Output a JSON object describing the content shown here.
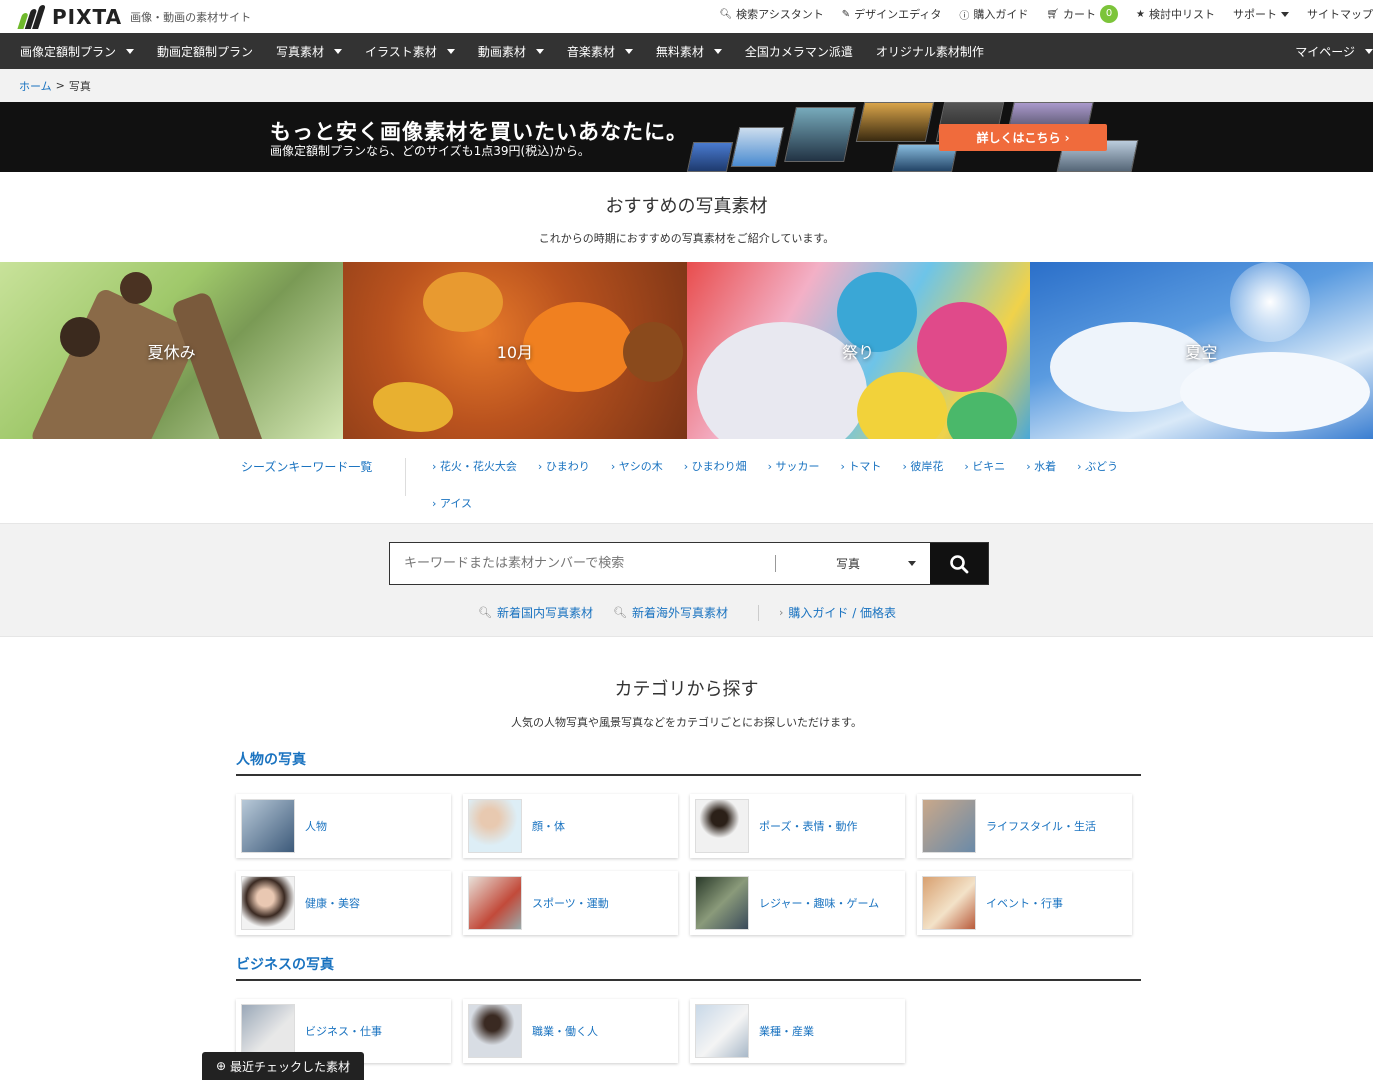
{
  "header": {
    "logo_text": "PIXTA",
    "tagline": "画像・動画の素材サイト",
    "util": {
      "assistant": "検索アシスタント",
      "editor": "デザインエディタ",
      "guide": "購入ガイド",
      "cart": "カート",
      "cart_count": "0",
      "wishlist": "検討中リスト",
      "support": "サポート",
      "sitemap": "サイトマップ"
    }
  },
  "nav": {
    "items": [
      {
        "label": "画像定額制プラン",
        "dropdown": true
      },
      {
        "label": "動画定額制プラン",
        "dropdown": false
      },
      {
        "label": "写真素材",
        "dropdown": true
      },
      {
        "label": "イラスト素材",
        "dropdown": true
      },
      {
        "label": "動画素材",
        "dropdown": true
      },
      {
        "label": "音楽素材",
        "dropdown": true
      },
      {
        "label": "無料素材",
        "dropdown": true
      },
      {
        "label": "全国カメラマン派遣",
        "dropdown": false
      },
      {
        "label": "オリジナル素材制作",
        "dropdown": false
      }
    ],
    "mypage": "マイページ"
  },
  "breadcrumb": {
    "home": "ホーム",
    "sep": ">",
    "current": "写真"
  },
  "banner": {
    "title": "もっと安く画像素材を買いたいあなたに。",
    "subtitle": "画像定額制プランなら、どのサイズも1点39円(税込)から。",
    "cta": "詳しくはこちら ›"
  },
  "recommend": {
    "title": "おすすめの写真素材",
    "subtitle": "これからの時期におすすめの写真素材をご紹介しています。",
    "tiles": [
      "夏休み",
      "10月",
      "祭り",
      "夏空"
    ]
  },
  "season": {
    "head": "シーズンキーワード一覧",
    "keywords": [
      "花火・花火大会",
      "ひまわり",
      "ヤシの木",
      "ひまわり畑",
      "サッカー",
      "トマト",
      "彼岸花",
      "ビキニ",
      "水着",
      "ぶどう",
      "アイス"
    ]
  },
  "search": {
    "placeholder": "キーワードまたは素材ナンバーで検索",
    "type": "写真",
    "links": [
      "新着国内写真素材",
      "新着海外写真素材",
      "購入ガイド / 価格表"
    ]
  },
  "categories": {
    "title": "カテゴリから探す",
    "subtitle": "人気の人物写真や風景写真などをカテゴリごとにお探しいただけます。",
    "groups": [
      {
        "heading": "人物の写真",
        "items": [
          "人物",
          "顔・体",
          "ポーズ・表情・動作",
          "ライフスタイル・生活",
          "健康・美容",
          "スポーツ・運動",
          "レジャー・趣味・ゲーム",
          "イベント・行事"
        ]
      },
      {
        "heading": "ビジネスの写真",
        "items": [
          "ビジネス・仕事",
          "職業・働く人",
          "業種・産業"
        ]
      }
    ]
  },
  "recent": "最近チェックした素材",
  "colors": {
    "accent": "#1a73c0",
    "nav_bg": "#333333",
    "cta": "#f06b3c",
    "badge": "#7cc43a"
  }
}
